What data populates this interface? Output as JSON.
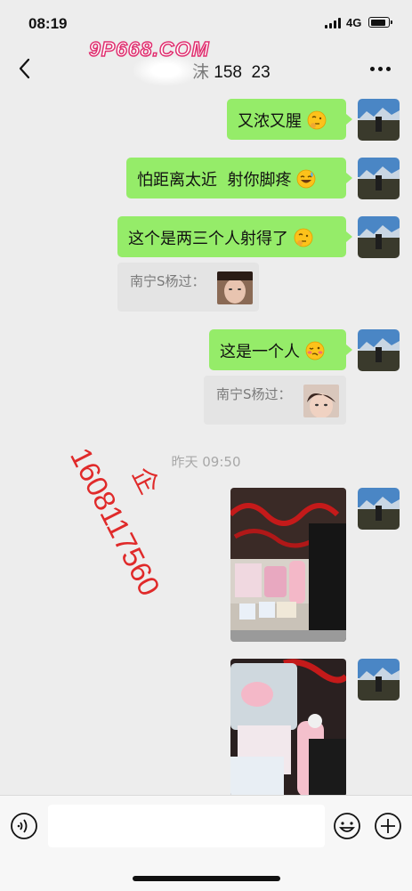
{
  "status_bar": {
    "time": "08:19",
    "network": "4G"
  },
  "nav": {
    "title": "158  23",
    "name_fragment": "沫"
  },
  "watermarks": {
    "site": "9P668.COM",
    "phone": "1608117560",
    "phone_suffix": "企"
  },
  "messages": [
    {
      "type": "text",
      "text": "又浓又腥",
      "emoji": "thinking-face"
    },
    {
      "type": "text",
      "text": "怕距离太近  射你脚疼",
      "emoji": "grinning-sweat-face"
    },
    {
      "type": "text",
      "text": "这个是两三个人射得了",
      "emoji": "thinking-face"
    },
    {
      "type": "quote",
      "author": "南宁S杨过："
    },
    {
      "type": "text",
      "text": "这是一个人",
      "emoji": "woozy-face"
    },
    {
      "type": "quote",
      "author": "南宁S杨过："
    }
  ],
  "timestamp": "昨天 09:50",
  "input": {
    "placeholder": ""
  },
  "colors": {
    "bubble_green": "#95ec69",
    "background": "#ededed",
    "watermark_red": "#e02a2a"
  }
}
